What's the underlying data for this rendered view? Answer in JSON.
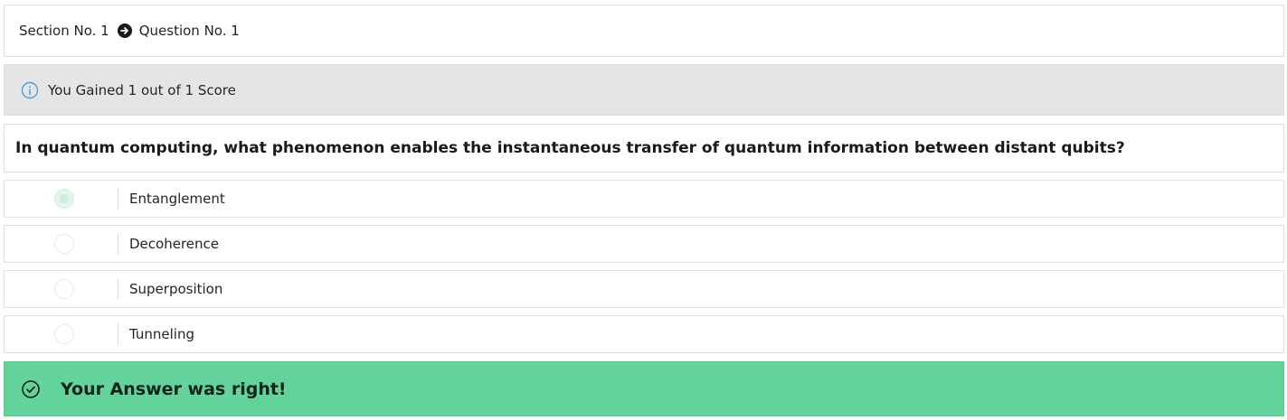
{
  "breadcrumb": {
    "section": "Section No. 1",
    "question": "Question No. 1",
    "separator_icon": "arrow-right-circle-icon"
  },
  "score": {
    "icon": "info-icon",
    "text": "You Gained 1 out of 1 Score",
    "icon_color": "#4aa3df"
  },
  "question": {
    "text": "In quantum computing, what phenomenon enables the instantaneous transfer of quantum information between distant qubits?"
  },
  "options": [
    {
      "label": "Entanglement",
      "selected": true
    },
    {
      "label": "Decoherence",
      "selected": false
    },
    {
      "label": "Superposition",
      "selected": false
    },
    {
      "label": "Tunneling",
      "selected": false
    }
  ],
  "result": {
    "icon": "check-circle-icon",
    "text": "Your Answer was right!",
    "color": "#63d29b"
  }
}
